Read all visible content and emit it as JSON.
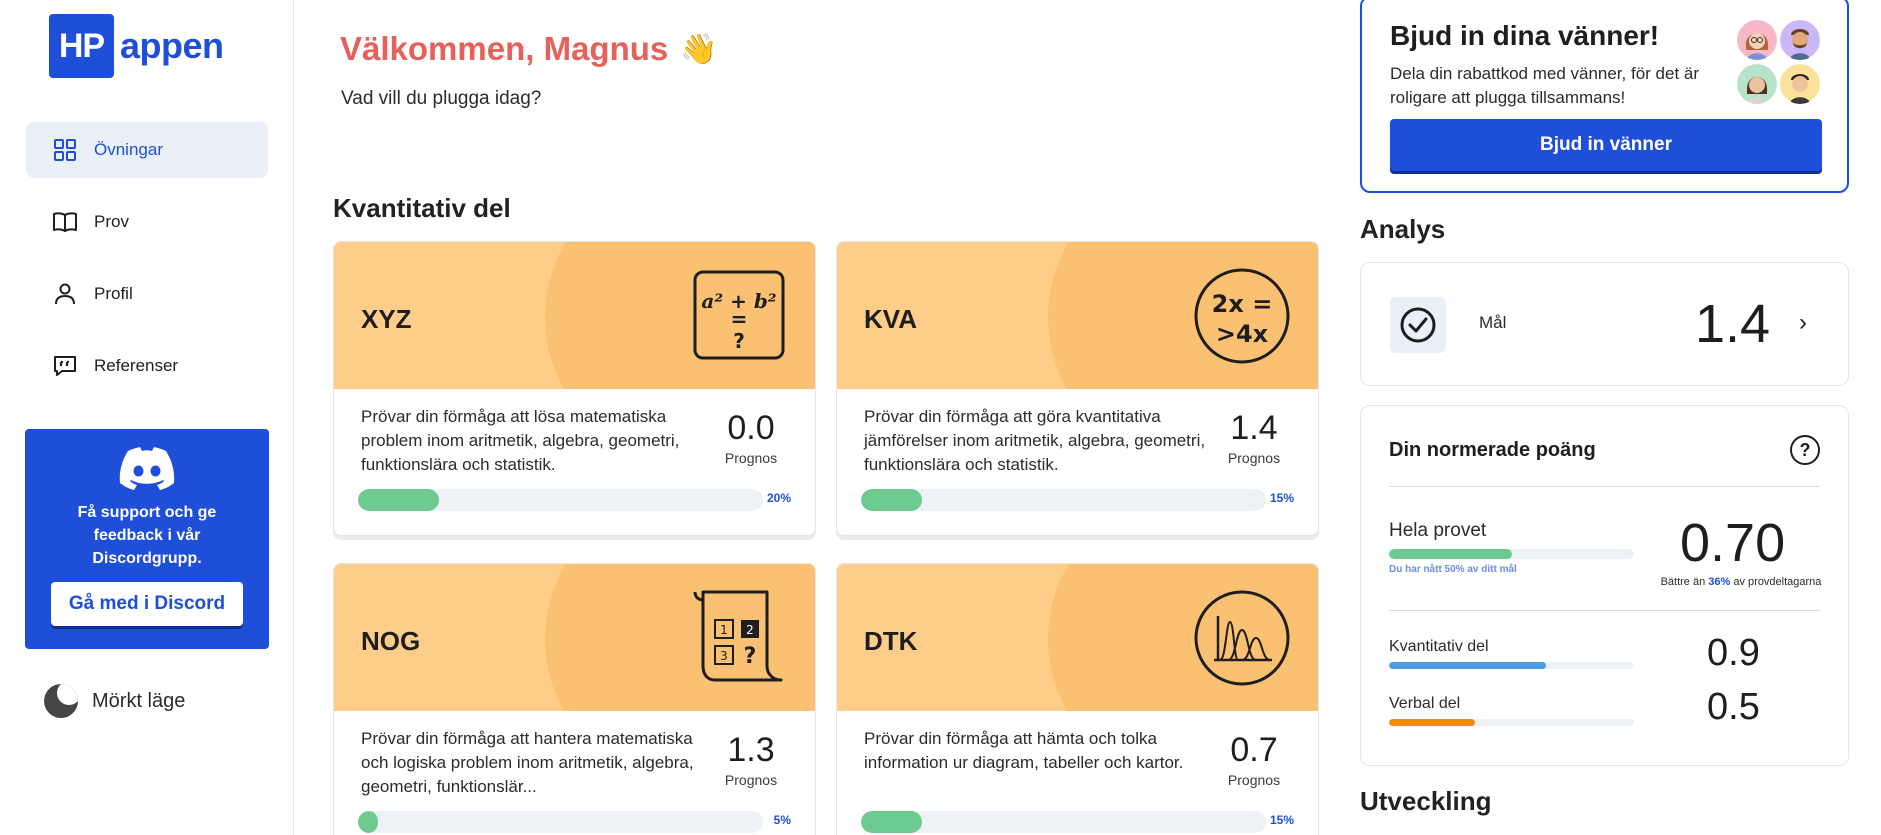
{
  "logo": {
    "box": "HP",
    "text": "appen"
  },
  "sidebar": {
    "items": [
      {
        "label": "Övningar",
        "icon": "grid-icon",
        "active": true
      },
      {
        "label": "Prov",
        "icon": "book-icon",
        "active": false
      },
      {
        "label": "Profil",
        "icon": "user-icon",
        "active": false
      },
      {
        "label": "Referenser",
        "icon": "quote-icon",
        "active": false
      }
    ],
    "discord": {
      "text": "Få support och ge feedback i vår Discordgrupp.",
      "button": "Gå med i Discord"
    },
    "dark_mode": "Mörkt läge"
  },
  "main": {
    "welcome": "Välkommen, Magnus",
    "wave": "👋",
    "subtitle": "Vad vill du plugga idag?",
    "section_title": "Kvantitativ del",
    "cards": [
      {
        "name": "XYZ",
        "desc": "Prövar din förmåga att lösa matematiska problem inom aritmetik, algebra, geometri, funktionslära och statistik.",
        "score": "0.0",
        "score_label": "Prognos",
        "progress": 20,
        "progress_label": "20%",
        "icon": "formula-icon"
      },
      {
        "name": "KVA",
        "desc": "Prövar din förmåga att göra kvantitativa jämförelser inom aritmetik, algebra, geometri, funktionslära och statistik.",
        "score": "1.4",
        "score_label": "Prognos",
        "progress": 15,
        "progress_label": "15%",
        "icon": "comparison-icon"
      },
      {
        "name": "NOG",
        "desc": "Prövar din förmåga att hantera matematiska och logiska problem inom aritmetik, algebra, geometri, funktionslär...",
        "score": "1.3",
        "score_label": "Prognos",
        "progress": 5,
        "progress_label": "5%",
        "icon": "scroll-icon"
      },
      {
        "name": "DTK",
        "desc": "Prövar din förmåga att hämta och tolka information ur diagram, tabeller och kartor.",
        "score": "0.7",
        "score_label": "Prognos",
        "progress": 15,
        "progress_label": "15%",
        "icon": "distribution-icon"
      }
    ]
  },
  "invite": {
    "title": "Bjud in dina vänner!",
    "text": "Dela din rabattkod med vänner, för det är roligare att plugga tillsammans!",
    "button": "Bjud in vänner"
  },
  "analysis": {
    "title": "Analys",
    "goal_label": "Mål",
    "goal_value": "1.4"
  },
  "normed": {
    "title": "Din normerade poäng",
    "total_label": "Hela provet",
    "total_score": "0.70",
    "goal_progress": 50,
    "goal_note": "Du har nått 50% av ditt mål",
    "better_prefix": "Bättre än",
    "better_pct": "36%",
    "better_suffix": "av provdeltagarna",
    "rows": [
      {
        "label": "Kvantitativ del",
        "score": "0.9",
        "progress": 64,
        "color": "#4a9fe0"
      },
      {
        "label": "Verbal del",
        "score": "0.5",
        "progress": 35,
        "color": "#f28a12"
      }
    ]
  },
  "development": {
    "title": "Utveckling"
  }
}
